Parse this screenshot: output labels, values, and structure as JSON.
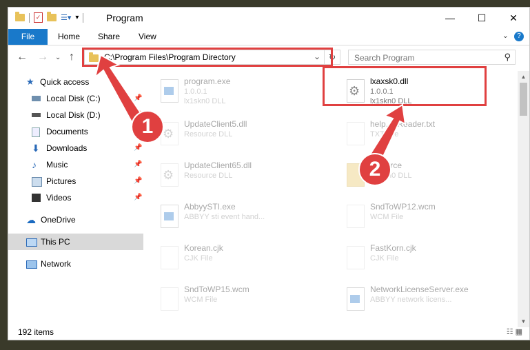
{
  "window": {
    "title": "Program",
    "controls": {
      "minimize": "—",
      "maximize": "☐",
      "close": "✕"
    }
  },
  "ribbon": {
    "tabs": [
      "File",
      "Home",
      "Share",
      "View"
    ],
    "help": "?"
  },
  "address": {
    "path": "C:\\Program Files\\Program Directory",
    "search_placeholder": "Search Program"
  },
  "sidebar": {
    "items": [
      {
        "label": "Quick access",
        "icon": "star-icon"
      },
      {
        "label": "Local Disk (C:)",
        "icon": "drive-icon"
      },
      {
        "label": "Local Disk (D:)",
        "icon": "drive-icon"
      },
      {
        "label": "Documents",
        "icon": "documents-icon"
      },
      {
        "label": "Downloads",
        "icon": "download-icon"
      },
      {
        "label": "Music",
        "icon": "music-icon"
      },
      {
        "label": "Pictures",
        "icon": "pictures-icon"
      },
      {
        "label": "Videos",
        "icon": "videos-icon"
      },
      {
        "label": "OneDrive",
        "icon": "cloud-icon"
      },
      {
        "label": "This PC",
        "icon": "computer-icon"
      },
      {
        "label": "Network",
        "icon": "network-icon"
      }
    ]
  },
  "files": [
    {
      "name": "program.exe",
      "l2": "1.0.0.1",
      "l3": "lx1skn0 DLL"
    },
    {
      "name": "lxaxsk0.dll",
      "l2": "1.0.0.1",
      "l3": "lx1skn0 DLL"
    },
    {
      "name": "UpdateClient5.dll",
      "l2": "Resource DLL",
      "l3": ""
    },
    {
      "name": "help...dReader.txt",
      "l2": "TXT File",
      "l3": ""
    },
    {
      "name": "UpdateClient65.dll",
      "l2": "Resource DLL",
      "l3": ""
    },
    {
      "name": "...source",
      "l2": "",
      "l3": "lx1skn0 DLL"
    },
    {
      "name": "AbbyySTI.exe",
      "l2": "ABBYY sti event hand...",
      "l3": ""
    },
    {
      "name": "SndToWP12.wcm",
      "l2": "WCM File",
      "l3": ""
    },
    {
      "name": "Korean.cjk",
      "l2": "CJK File",
      "l3": ""
    },
    {
      "name": "FastKorn.cjk",
      "l2": "CJK File",
      "l3": ""
    },
    {
      "name": "SndToWP15.wcm",
      "l2": "WCM File",
      "l3": ""
    },
    {
      "name": "NetworkLicenseServer.exe",
      "l2": "ABBYY network licens...",
      "l3": ""
    }
  ],
  "status": {
    "count": "192 items"
  },
  "callouts": [
    "1",
    "2"
  ],
  "colors": {
    "accent": "#1979ca",
    "highlight": "#e04040"
  }
}
